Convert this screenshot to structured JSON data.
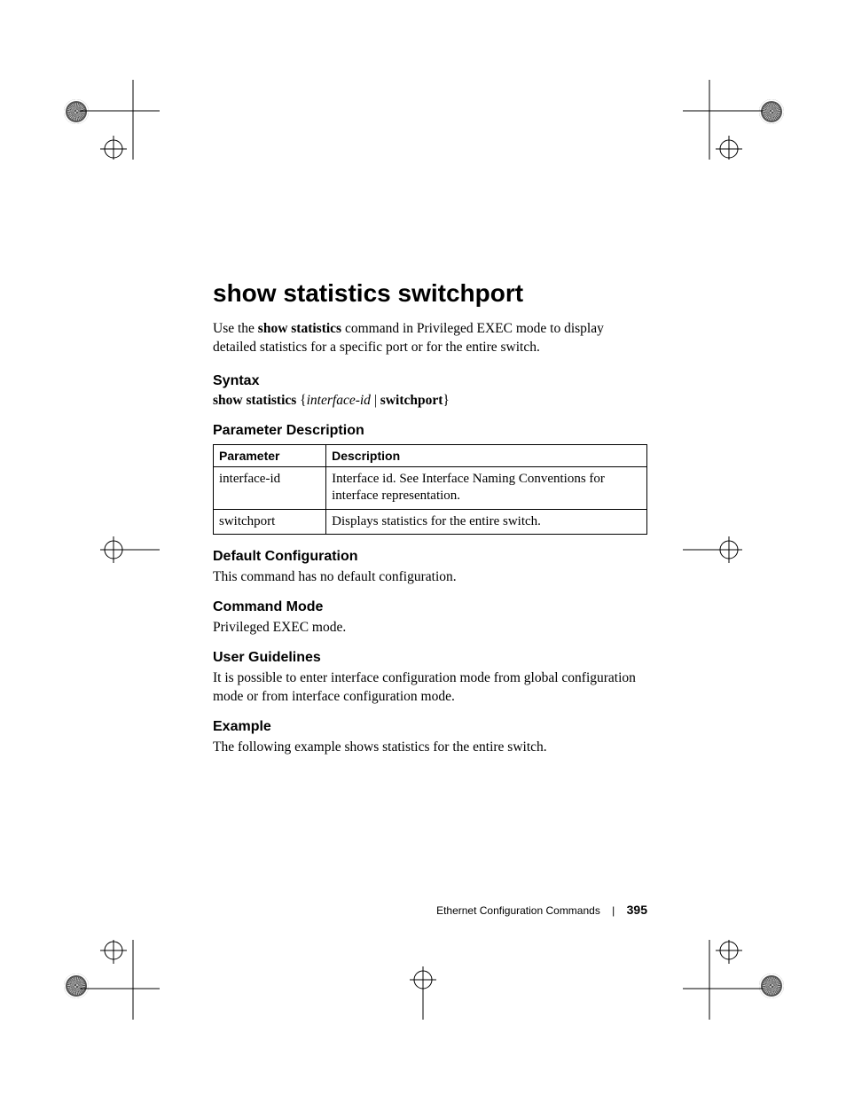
{
  "title": "show statistics switchport",
  "intro_pre": "Use the ",
  "intro_cmd": "show statistics",
  "intro_post": " command in Privileged EXEC mode to display detailed statistics for a specific port or for the entire switch.",
  "syntax": {
    "heading": "Syntax",
    "cmd": "show statistics",
    "brace_open": " {",
    "arg": "interface-id",
    "pipe": " |",
    "kw": "switchport",
    "brace_close": "}"
  },
  "param_desc": {
    "heading": "Parameter Description",
    "headers": {
      "p": "Parameter",
      "d": "Description"
    },
    "rows": [
      {
        "p": "interface-id",
        "d": "Interface id. See Interface Naming Conventions for interface representation."
      },
      {
        "p": "switchport",
        "d": "Displays statistics for the entire switch."
      }
    ]
  },
  "default_cfg": {
    "heading": "Default Configuration",
    "text": "This command has no default configuration."
  },
  "cmd_mode": {
    "heading": "Command Mode",
    "text": "Privileged EXEC mode."
  },
  "guidelines": {
    "heading": "User Guidelines",
    "text": "It is possible to enter interface configuration mode from global configuration mode or from interface configuration mode."
  },
  "example": {
    "heading": "Example",
    "text": "The following example shows statistics for the entire switch."
  },
  "footer": {
    "section": "Ethernet Configuration Commands",
    "page": "395"
  }
}
